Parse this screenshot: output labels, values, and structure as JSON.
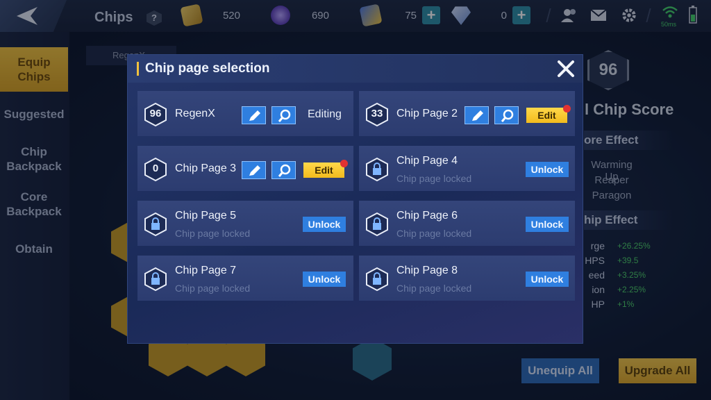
{
  "header": {
    "title": "Chips",
    "help_label": "?",
    "resources": [
      {
        "name": "gold",
        "value": "520"
      },
      {
        "name": "crystal",
        "value": "690"
      },
      {
        "name": "card-ticket",
        "value": "75"
      },
      {
        "name": "diamond",
        "value": "0"
      }
    ],
    "ping": "50ms"
  },
  "sidebar": {
    "items": [
      {
        "label": "Equip Chips",
        "active": true
      },
      {
        "label": "Suggested"
      },
      {
        "label": "Chip Backpack"
      },
      {
        "label": "Core Backpack"
      },
      {
        "label": "Obtain"
      }
    ]
  },
  "background": {
    "tab_label": "RegenX",
    "score": "96",
    "score_label": "l Chip Score",
    "core_effect_title": "ore Effect",
    "core_effects": [
      "Warming Up",
      "Reaper",
      "Paragon"
    ],
    "chip_effect_title": "hip Effect",
    "stats": [
      {
        "name": "rge",
        "value": "+26.25%"
      },
      {
        "name": "HPS",
        "value": "+39.5"
      },
      {
        "name": "eed",
        "value": "+3.25%"
      },
      {
        "name": "ion",
        "value": "+2.25%"
      },
      {
        "name": "HP",
        "value": "+1%"
      }
    ],
    "unequip_all": "Unequip All",
    "upgrade_all": "Upgrade All"
  },
  "modal": {
    "title": "Chip page selection",
    "pages": [
      {
        "score": "96",
        "name": "RegenX",
        "locked": false,
        "status": "Editing"
      },
      {
        "score": "33",
        "name": "Chip Page 2",
        "locked": false,
        "action": "Edit",
        "badge": true
      },
      {
        "score": "0",
        "name": "Chip Page 3",
        "locked": false,
        "action": "Edit",
        "badge": true
      },
      {
        "name": "Chip Page 4",
        "locked": true,
        "locked_text": "Chip page locked",
        "action": "Unlock"
      },
      {
        "name": "Chip Page 5",
        "locked": true,
        "locked_text": "Chip page locked",
        "action": "Unlock"
      },
      {
        "name": "Chip Page 6",
        "locked": true,
        "locked_text": "Chip page locked",
        "action": "Unlock"
      },
      {
        "name": "Chip Page 7",
        "locked": true,
        "locked_text": "Chip page locked",
        "action": "Unlock"
      },
      {
        "name": "Chip Page 8",
        "locked": true,
        "locked_text": "Chip page locked",
        "action": "Unlock"
      }
    ]
  },
  "colors": {
    "accent_yellow": "#f2c23e",
    "button_blue": "#2f7fe0",
    "positive_green": "#4dd06a",
    "notification_red": "#e23232"
  }
}
